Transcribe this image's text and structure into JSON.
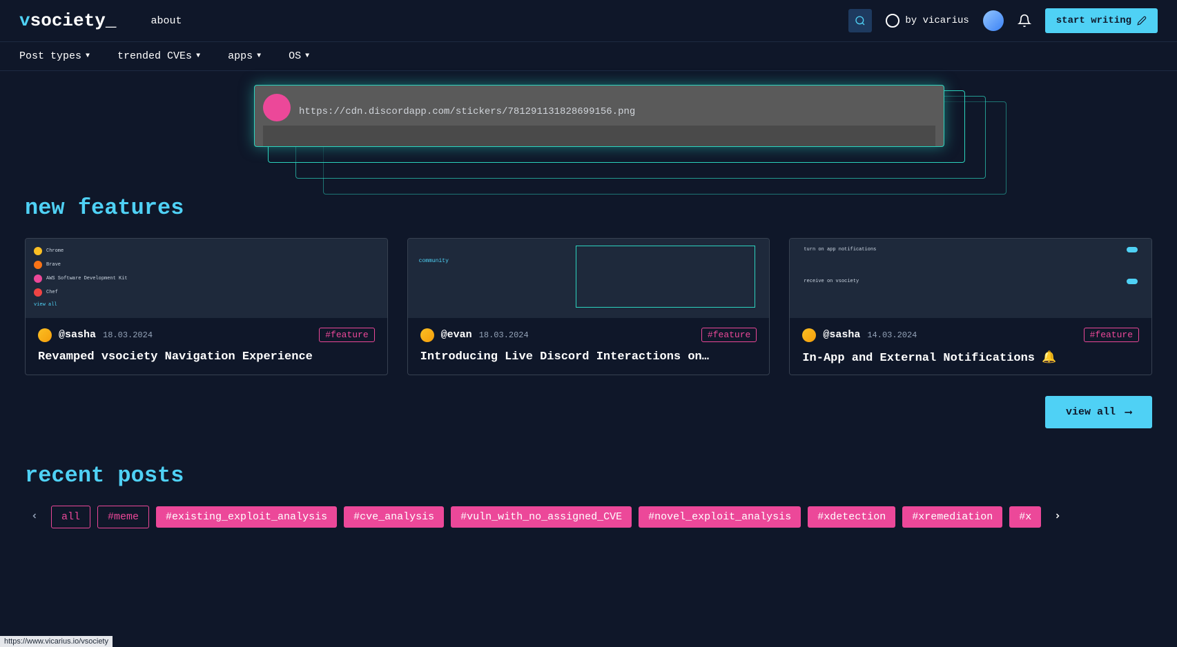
{
  "header": {
    "logo_prefix": "v",
    "logo_text": "society_",
    "about": "about",
    "by_vicarius": "by vicarius",
    "start_writing": "start writing"
  },
  "nav": {
    "post_types": "Post types",
    "trended_cves": "trended CVEs",
    "apps": "apps",
    "os": "OS"
  },
  "hero": {
    "url": "https://cdn.discordapp.com/stickers/781291131828699156.png"
  },
  "sections": {
    "new_features": "new features",
    "recent_posts": "recent posts",
    "view_all": "view all"
  },
  "features": [
    {
      "handle": "@sasha",
      "date": "18.03.2024",
      "tag": "#feature",
      "title": "Revamped vsociety Navigation Experience"
    },
    {
      "handle": "@evan",
      "date": "18.03.2024",
      "tag": "#feature",
      "title": "Introducing Live Discord Interactions on…"
    },
    {
      "handle": "@sasha",
      "date": "14.03.2024",
      "tag": "#feature",
      "title": "In-App and External Notifications 🔔"
    }
  ],
  "tags": {
    "outline": [
      "all",
      "#meme"
    ],
    "filled": [
      "#existing_exploit_analysis",
      "#cve_analysis",
      "#vuln_with_no_assigned_CVE",
      "#novel_exploit_analysis",
      "#xdetection",
      "#xremediation",
      "#x"
    ]
  },
  "status_url": "https://www.vicarius.io/vsociety"
}
